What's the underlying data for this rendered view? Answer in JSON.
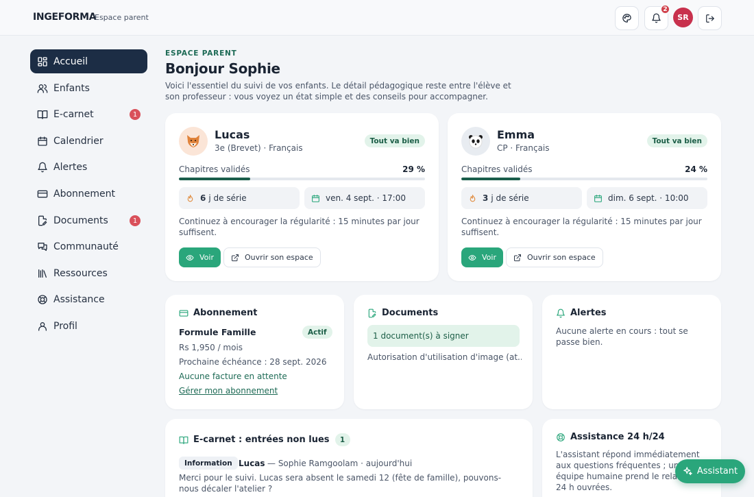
{
  "header": {
    "brand": "INGEFORMA",
    "subtitle": "Espace parent",
    "palette_icon": "palette-icon",
    "bell_icon": "bell-icon",
    "notifications_count": "2",
    "avatar_initials": "SR",
    "logout_icon": "logout-icon"
  },
  "sidebar": {
    "items": [
      {
        "label": "Accueil",
        "icon": "dashboard-icon",
        "active": true
      },
      {
        "label": "Enfants",
        "icon": "users-icon"
      },
      {
        "label": "E-carnet",
        "icon": "book-icon",
        "badge": "1"
      },
      {
        "label": "Calendrier",
        "icon": "calendar-icon"
      },
      {
        "label": "Alertes",
        "icon": "bell-icon"
      },
      {
        "label": "Abonnement",
        "icon": "credit-card-icon"
      },
      {
        "label": "Documents",
        "icon": "document-edit-icon",
        "badge": "1"
      },
      {
        "label": "Communauté",
        "icon": "chat-icon"
      },
      {
        "label": "Ressources",
        "icon": "library-icon"
      },
      {
        "label": "Assistance",
        "icon": "lifebuoy-icon"
      },
      {
        "label": "Profil",
        "icon": "user-icon"
      }
    ]
  },
  "intro": {
    "eyebrow": "ESPACE PARENT",
    "greeting": "Bonjour Sophie",
    "description": "Voici l'essentiel du suivi de vos enfants. Le détail pédagogique reste entre l'élève et son professeur : vous voyez un état simple et des conseils pour accompagner."
  },
  "children": [
    {
      "name": "Lucas",
      "meta": "3e (Brevet) · Français",
      "status": "Tout va bien",
      "avatar_icon": "fox-icon",
      "progress_label": "Chapitres validés",
      "progress_text": "29 %",
      "progress": 0.29,
      "streak_num": "6",
      "streak_text": "j de série",
      "next_session": "ven. 4 sept. · 17:00",
      "advice": "Continuez à encourager la régularité : 15 minutes par jour suffisent.",
      "view_label": "Voir",
      "open_label": "Ouvrir son espace"
    },
    {
      "name": "Emma",
      "meta": "CP · Français",
      "status": "Tout va bien",
      "avatar_icon": "panda-icon",
      "progress_label": "Chapitres validés",
      "progress_text": "24 %",
      "progress": 0.24,
      "streak_num": "3",
      "streak_text": "j de série",
      "next_session": "dim. 6 sept. · 10:00",
      "advice": "Continuez à encourager la régularité : 15 minutes par jour suffisent.",
      "view_label": "Voir",
      "open_label": "Ouvrir son espace"
    }
  ],
  "subscription": {
    "title": "Abonnement",
    "plan": "Formule Famille",
    "status": "Actif",
    "price": "Rs 1,950 / mois",
    "next_due": "Prochaine échéance : 28 sept. 2026",
    "invoices": "Aucune facture en attente",
    "manage_link": "Gérer mon abonnement"
  },
  "documents": {
    "title": "Documents",
    "to_sign": "1 document(s) à signer",
    "item": "Autorisation d'utilisation d'image (at..."
  },
  "alerts": {
    "title": "Alertes",
    "text": "Aucune alerte en cours : tout se passe bien."
  },
  "ecarnet": {
    "title": "E-carnet : entrées non lues",
    "count": "1",
    "entry_tag": "Information",
    "entry_child": "Lucas",
    "entry_meta": "— Sophie Ramgoolam · aujourd'hui",
    "entry_text": "Merci pour le suivi. Lucas sera absent le samedi 12 (fête de famille), pouvons-nous décaler l'atelier ?"
  },
  "assistance": {
    "title": "Assistance 24 h/24",
    "text": "L'assistant répond immédiatement aux questions fréquentes ; une équipe humaine prend le relais sous 24 h ouvrées.",
    "assistant_button": "Assistant"
  },
  "colors": {
    "accent_green": "#2aa67b",
    "nav_active": "#1c2d45",
    "badge_red": "#d9505a"
  }
}
